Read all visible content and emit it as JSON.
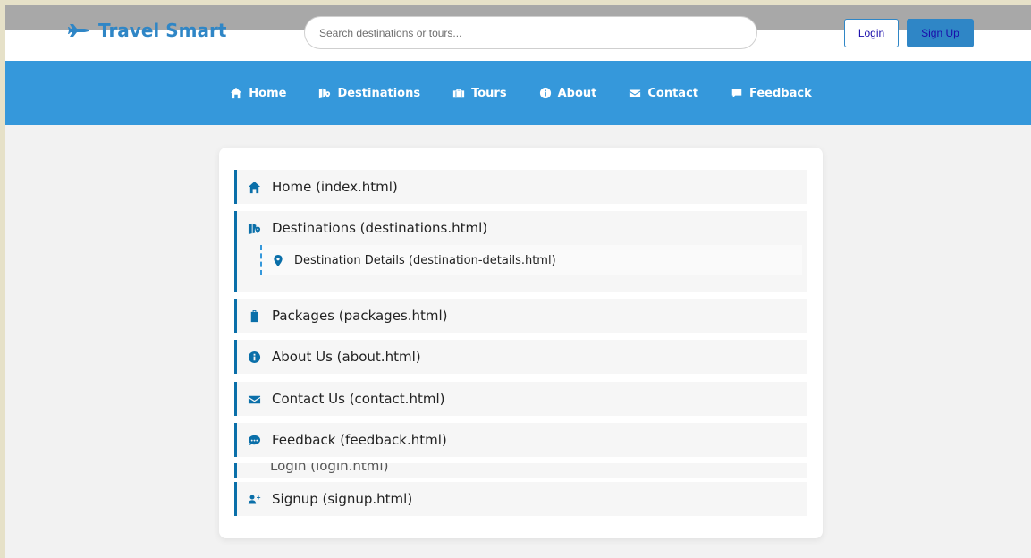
{
  "header": {
    "brand": "Travel Smart",
    "search_placeholder": "Search destinations or tours...",
    "login_label": "Login",
    "signup_label": "Sign Up"
  },
  "nav": {
    "items": [
      {
        "label": "Home",
        "icon": "home-icon"
      },
      {
        "label": "Destinations",
        "icon": "map-marker-icon"
      },
      {
        "label": "Tours",
        "icon": "suitcase-icon"
      },
      {
        "label": "About",
        "icon": "info-icon"
      },
      {
        "label": "Contact",
        "icon": "envelope-icon"
      },
      {
        "label": "Feedback",
        "icon": "comment-icon"
      }
    ]
  },
  "sitemap": {
    "home": "Home (index.html)",
    "destinations": "Destinations (destinations.html)",
    "destination_details": "Destination Details (destination-details.html)",
    "packages": "Packages (packages.html)",
    "about": "About Us (about.html)",
    "contact": "Contact Us (contact.html)",
    "feedback": "Feedback (feedback.html)",
    "clipped": "Login (login.html)",
    "signup": "Signup (signup.html)"
  },
  "colors": {
    "brand": "#2f86c6",
    "nav_bg": "#3598db",
    "accent": "#0a6fa9"
  }
}
